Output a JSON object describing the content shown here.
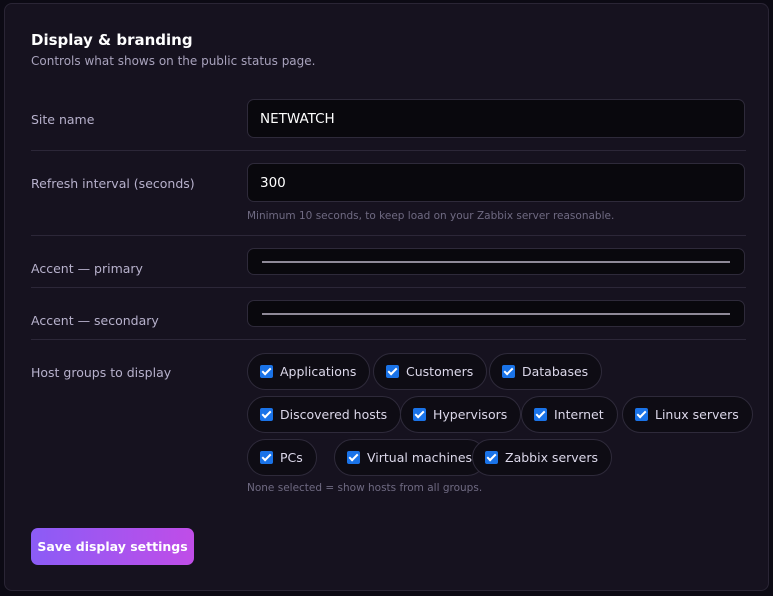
{
  "section": {
    "title": "Display & branding",
    "subtitle": "Controls what shows on the public status page."
  },
  "fields": {
    "site_name": {
      "label": "Site name",
      "value": "NETWATCH"
    },
    "refresh_interval": {
      "label": "Refresh interval (seconds)",
      "value": "300",
      "hint": "Minimum 10 seconds, to keep load on your Zabbix server reasonable."
    },
    "accent_primary": {
      "label": "Accent — primary",
      "color": "#8f8a98"
    },
    "accent_secondary": {
      "label": "Accent — secondary",
      "color": "#8f8a98"
    }
  },
  "host_groups": {
    "label": "Host groups to display",
    "options": [
      {
        "label": "Applications",
        "checked": true
      },
      {
        "label": "Customers",
        "checked": true
      },
      {
        "label": "Databases",
        "checked": true
      },
      {
        "label": "Discovered hosts",
        "checked": true
      },
      {
        "label": "Hypervisors",
        "checked": true
      },
      {
        "label": "Internet",
        "checked": true
      },
      {
        "label": "Linux servers",
        "checked": true
      },
      {
        "label": "PCs",
        "checked": true
      },
      {
        "label": "Virtual machines",
        "checked": true
      },
      {
        "label": "Zabbix servers",
        "checked": true
      }
    ],
    "hint": "None selected = show hosts from all groups."
  },
  "actions": {
    "save_label": "Save display settings"
  },
  "colors": {
    "background": "#0c0a14",
    "card": "#16121f",
    "checkbox": "#1a73e8",
    "button_gradient_start": "#8b5cf6",
    "button_gradient_end": "#c04de8"
  }
}
